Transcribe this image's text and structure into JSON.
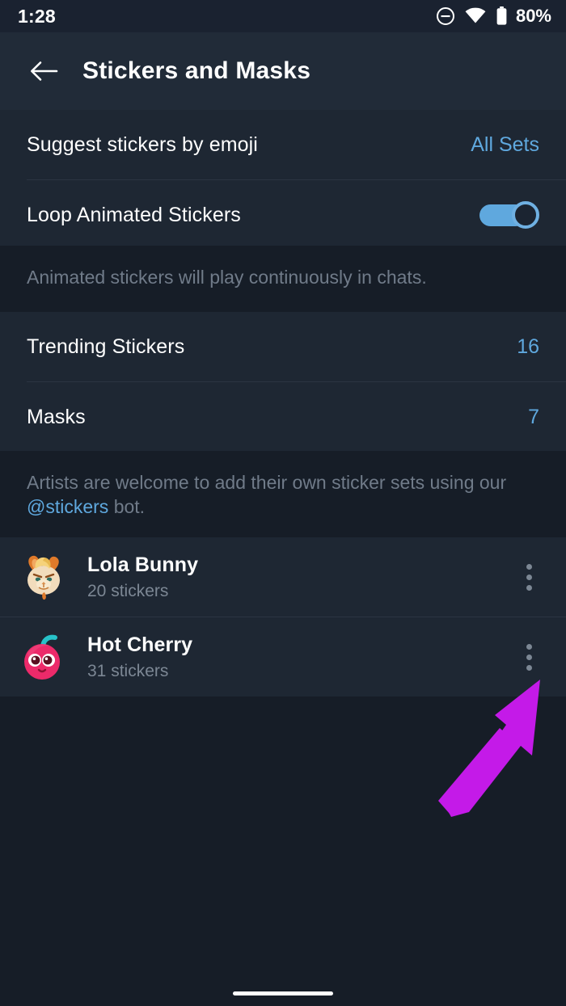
{
  "status_bar": {
    "time": "1:28",
    "battery_percent": "80%",
    "icons": [
      "dnd-icon",
      "wifi-icon",
      "battery-icon"
    ]
  },
  "app_bar": {
    "back_icon": "arrow-left-icon",
    "title": "Stickers and Masks"
  },
  "colors": {
    "background": "#161d27",
    "surface": "#1e2733",
    "app_bar": "#212b38",
    "status_bar": "#1a2230",
    "accent": "#5fa8de",
    "primary_text": "#ffffff",
    "secondary_text": "#707b89",
    "divider": "#2b3442",
    "annotation_arrow": "#c41ae8"
  },
  "settings_section_1": {
    "rows": [
      {
        "label": "Suggest stickers by emoji",
        "value": "All Sets",
        "type": "value"
      },
      {
        "label": "Loop Animated Stickers",
        "value": "on",
        "type": "switch"
      }
    ]
  },
  "footnote_1": {
    "text": "Animated stickers will play continuously in chats."
  },
  "settings_section_2": {
    "rows": [
      {
        "label": "Trending Stickers",
        "value": "16",
        "type": "value"
      },
      {
        "label": "Masks",
        "value": "7",
        "type": "value"
      }
    ]
  },
  "footnote_2": {
    "text_before": "Artists are welcome to add their own sticker sets using our ",
    "link": "@stickers",
    "text_after": " bot."
  },
  "sticker_sets": [
    {
      "name": "Lola Bunny",
      "count": "20 stickers",
      "thumb_icon": "bunny-face-sticker-thumb",
      "menu_icon": "more-vertical-icon"
    },
    {
      "name": "Hot Cherry",
      "count": "31 stickers",
      "thumb_icon": "cherry-face-sticker-thumb",
      "menu_icon": "more-vertical-icon"
    }
  ],
  "annotation": {
    "icon": "arrow-up-right-annotation",
    "points_to": "Hot Cherry overflow menu"
  },
  "nav_bar": {
    "pill": "gesture-home-pill"
  }
}
